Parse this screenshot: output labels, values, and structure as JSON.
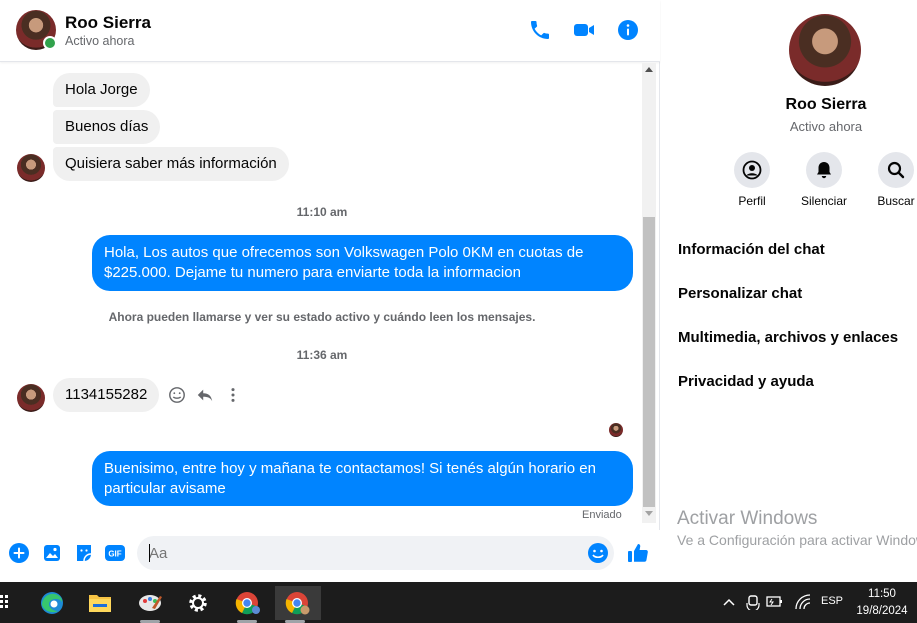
{
  "header": {
    "contact_name": "Roo Sierra",
    "status": "Activo ahora"
  },
  "messages": {
    "in_1": "Hola Jorge",
    "in_2": "Buenos días",
    "in_3": "Quisiera saber más información",
    "time_1": "11:10 am",
    "out_1": "Hola, Los autos que ofrecemos son Volkswagen Polo 0KM en cuotas de $225.000. Dejame tu numero para enviarte toda la informacion",
    "system": "Ahora pueden llamarse y ver su estado activo y cuándo leen los mensajes.",
    "time_2": "11:36 am",
    "in_4": "1134155282",
    "out_2": "Buenisimo, entre hoy y mañana te contactamos! Si tenés algún horario en particular avisame",
    "sent_label": "Enviado"
  },
  "composer": {
    "placeholder": "Aa"
  },
  "panel": {
    "name": "Roo Sierra",
    "status": "Activo ahora",
    "actions": [
      "Perfil",
      "Silenciar",
      "Buscar"
    ],
    "items": [
      "Información del chat",
      "Personalizar chat",
      "Multimedia, archivos y enlaces",
      "Privacidad y ayuda"
    ],
    "watermark_title": "Activar Windows",
    "watermark_sub": "Ve a Configuración para activar Windows."
  },
  "taskbar": {
    "lang": "ESP",
    "time": "11:50",
    "date": "19/8/2024"
  },
  "colors": {
    "accent": "#0084ff",
    "online": "#31a24c"
  }
}
